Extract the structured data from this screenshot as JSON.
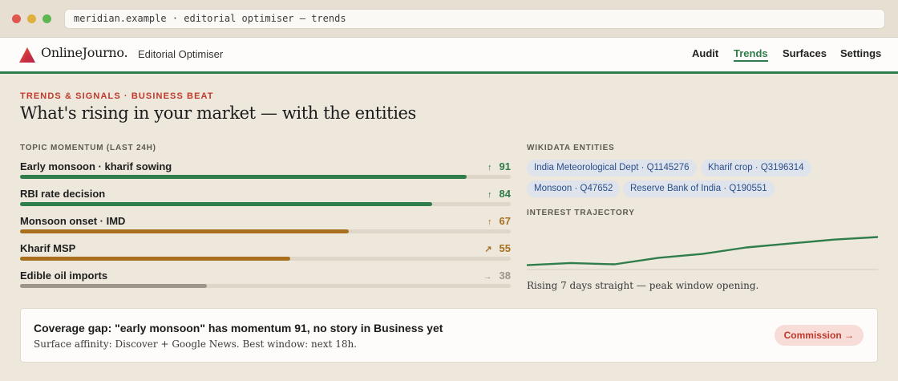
{
  "browser": {
    "url": "meridian.example · editorial optimiser — trends"
  },
  "app": {
    "brand": "OnlineJourno.",
    "product": "Editorial Optimiser",
    "nav": [
      "Audit",
      "Trends",
      "Surfaces",
      "Settings"
    ],
    "active_nav": "Trends"
  },
  "header": {
    "eyebrow": "TRENDS & SIGNALS · BUSINESS BEAT",
    "title": "What's rising in your market — with the entities"
  },
  "momentum": {
    "label": "TOPIC MOMENTUM (LAST 24H)",
    "topics": [
      {
        "name": "Early monsoon · kharif sowing",
        "arrow": "↑",
        "score": "91",
        "level": 0.91,
        "color": "#2f7d4a"
      },
      {
        "name": "RBI rate decision",
        "arrow": "↑",
        "score": "84",
        "level": 0.84,
        "color": "#2f7d4a"
      },
      {
        "name": "Monsoon onset · IMD",
        "arrow": "↑",
        "score": "67",
        "level": 0.67,
        "color": "#a86f1f"
      },
      {
        "name": "Kharif MSP",
        "arrow": "↗",
        "score": "55",
        "level": 0.55,
        "color": "#a86f1f"
      },
      {
        "name": "Edible oil imports",
        "arrow": "→",
        "score": "38",
        "level": 0.38,
        "color": "#9b958a"
      }
    ]
  },
  "entities": {
    "label": "WIKIDATA ENTITIES",
    "chips": [
      "India Meteorological Dept · Q1145276",
      "Kharif crop · Q3196314",
      "Monsoon · Q47652",
      "Reserve Bank of India · Q190551"
    ]
  },
  "trajectory": {
    "label": "INTEREST TRAJECTORY",
    "caption": "Rising 7 days straight — peak window opening.",
    "line_color": "#2f7d4a"
  },
  "chart_data": {
    "type": "line",
    "title": "",
    "xlabel": "",
    "ylabel": "",
    "grid": false,
    "series": [
      {
        "values": [
          10,
          15,
          12,
          27,
          36,
          51,
          60,
          69,
          75
        ]
      }
    ],
    "ylim": [
      0,
      100
    ]
  },
  "callout": {
    "headline": "Coverage gap: \"early monsoon\" has momentum 91, no story in Business yet",
    "detail": "Surface affinity: Discover + Google News. Best window: next 18h.",
    "action": "Commission →"
  },
  "colors": {
    "accent_green": "#2f7d4a",
    "accent_red": "#c0392b",
    "amber": "#a86f1f",
    "chip_bg": "#dfe4ec"
  }
}
